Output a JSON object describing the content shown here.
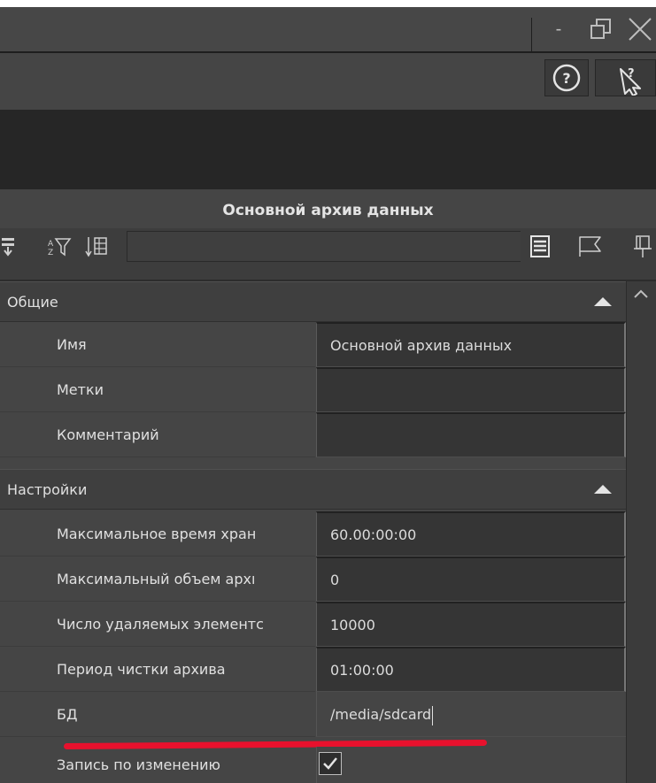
{
  "colors": {
    "accent_underline": "#e8112d",
    "panel_bg": "#444444",
    "value_bg": "#353535"
  },
  "window": {
    "minimize_label": "-",
    "restore_icon": "restore-icon",
    "close_icon": "close-icon"
  },
  "help": {
    "help_icon": "help-circle-icon",
    "help_glyph": "?",
    "pointer_icon": "context-help-pointer-icon"
  },
  "panel": {
    "title": "Основной архив данных"
  },
  "toolbar": {
    "left_icons": [
      "expand-rows-icon",
      "sort-filter-icon",
      "sort-icon"
    ],
    "right_icons": [
      "list-view-icon",
      "flag-icon",
      "pin-icon"
    ],
    "search_value": ""
  },
  "sections": [
    {
      "title": "Общие",
      "rows": [
        {
          "name": "Имя",
          "value": "Основной архив данных"
        },
        {
          "name": "Метки",
          "value": ""
        },
        {
          "name": "Комментарий",
          "value": ""
        }
      ]
    },
    {
      "title": "Настройки",
      "rows": [
        {
          "name": "Максимальное время хран",
          "value": "60.00:00:00"
        },
        {
          "name": "Максимальный объем архı",
          "value": "0"
        },
        {
          "name": "Число удаляемых элементс",
          "value": "10000"
        },
        {
          "name": "Период чистки архива",
          "value": "01:00:00"
        },
        {
          "name": "БД",
          "value": "/media/sdcard"
        },
        {
          "name": "Запись по изменению",
          "checked": true
        }
      ]
    }
  ]
}
